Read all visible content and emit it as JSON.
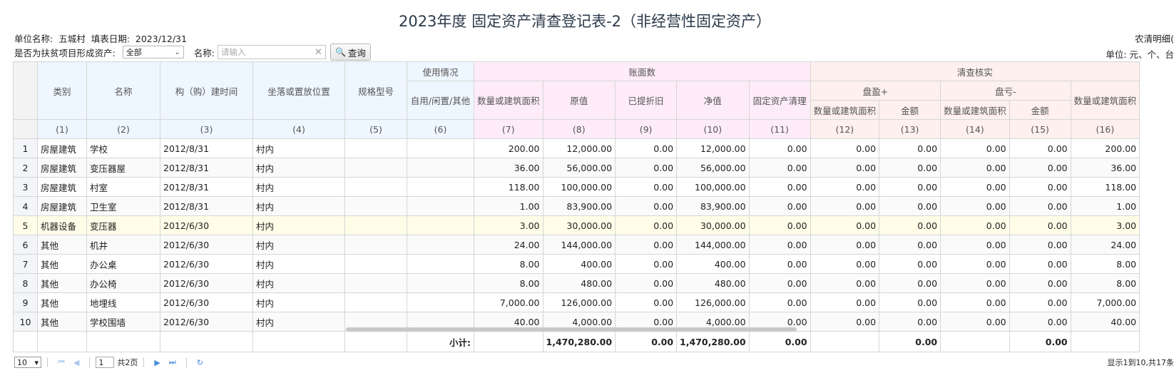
{
  "title": "2023年度 固定资产清查登记表-2（非经营性固定资产）",
  "meta": {
    "unit_label": "单位名称:",
    "unit_value": "五城村",
    "date_label": "填表日期:",
    "date_value": "2023/12/31",
    "right_top": "农清明细(",
    "right_unit": "单位: 元、个、台"
  },
  "filters": {
    "poverty_label": "是否为扶贫项目形成资产:",
    "poverty_value": "全部",
    "name_label": "名称:",
    "name_placeholder": "请输入",
    "query_label": "查询"
  },
  "headers": {
    "category": "类别",
    "name": "名称",
    "built_time": "构（购）建时间",
    "location": "坐落或置放位置",
    "spec": "规格型号",
    "usage_group": "使用情况",
    "usage": "自用/闲置/其他",
    "book_group": "账面数",
    "qty_area": "数量或建筑面积",
    "original": "原值",
    "depreciation": "已提折旧",
    "net": "净值",
    "cleanup": "固定资产清理",
    "verify_group": "清查核实",
    "surplus_group": "盘盈+",
    "loss_group": "盘亏-",
    "amount": "金额",
    "codes": [
      "(1)",
      "(2)",
      "(3)",
      "(4)",
      "(5)",
      "(6)",
      "(7)",
      "(8)",
      "(9)",
      "(10)",
      "(11)",
      "(12)",
      "(13)",
      "(14)",
      "(15)",
      "(16)"
    ]
  },
  "rows": [
    {
      "no": "1",
      "cat": "房屋建筑",
      "name": "学校",
      "time": "2012/8/31",
      "loc": "村内",
      "spec": "",
      "usage": "",
      "qty": "200.00",
      "orig": "12,000.00",
      "dep": "0.00",
      "net": "12,000.00",
      "clean": "0.00",
      "s_qty": "0.00",
      "s_amt": "0.00",
      "l_qty": "0.00",
      "l_amt": "0.00",
      "v_qty": "200.00"
    },
    {
      "no": "2",
      "cat": "房屋建筑",
      "name": "变压器屋",
      "time": "2012/8/31",
      "loc": "村内",
      "spec": "",
      "usage": "",
      "qty": "36.00",
      "orig": "56,000.00",
      "dep": "0.00",
      "net": "56,000.00",
      "clean": "0.00",
      "s_qty": "0.00",
      "s_amt": "0.00",
      "l_qty": "0.00",
      "l_amt": "0.00",
      "v_qty": "36.00"
    },
    {
      "no": "3",
      "cat": "房屋建筑",
      "name": "村室",
      "time": "2012/8/31",
      "loc": "村内",
      "spec": "",
      "usage": "",
      "qty": "118.00",
      "orig": "100,000.00",
      "dep": "0.00",
      "net": "100,000.00",
      "clean": "0.00",
      "s_qty": "0.00",
      "s_amt": "0.00",
      "l_qty": "0.00",
      "l_amt": "0.00",
      "v_qty": "118.00"
    },
    {
      "no": "4",
      "cat": "房屋建筑",
      "name": "卫生室",
      "time": "2012/8/31",
      "loc": "村内",
      "spec": "",
      "usage": "",
      "qty": "1.00",
      "orig": "83,900.00",
      "dep": "0.00",
      "net": "83,900.00",
      "clean": "0.00",
      "s_qty": "0.00",
      "s_amt": "0.00",
      "l_qty": "0.00",
      "l_amt": "0.00",
      "v_qty": "1.00"
    },
    {
      "no": "5",
      "cat": "机器设备",
      "name": "变压器",
      "time": "2012/6/30",
      "loc": "村内",
      "spec": "",
      "usage": "",
      "qty": "3.00",
      "orig": "30,000.00",
      "dep": "0.00",
      "net": "30,000.00",
      "clean": "0.00",
      "s_qty": "0.00",
      "s_amt": "0.00",
      "l_qty": "0.00",
      "l_amt": "0.00",
      "v_qty": "3.00"
    },
    {
      "no": "6",
      "cat": "其他",
      "name": "机井",
      "time": "2012/6/30",
      "loc": "村内",
      "spec": "",
      "usage": "",
      "qty": "24.00",
      "orig": "144,000.00",
      "dep": "0.00",
      "net": "144,000.00",
      "clean": "0.00",
      "s_qty": "0.00",
      "s_amt": "0.00",
      "l_qty": "0.00",
      "l_amt": "0.00",
      "v_qty": "24.00"
    },
    {
      "no": "7",
      "cat": "其他",
      "name": "办公桌",
      "time": "2012/6/30",
      "loc": "村内",
      "spec": "",
      "usage": "",
      "qty": "8.00",
      "orig": "400.00",
      "dep": "0.00",
      "net": "400.00",
      "clean": "0.00",
      "s_qty": "0.00",
      "s_amt": "0.00",
      "l_qty": "0.00",
      "l_amt": "0.00",
      "v_qty": "8.00"
    },
    {
      "no": "8",
      "cat": "其他",
      "name": "办公椅",
      "time": "2012/6/30",
      "loc": "村内",
      "spec": "",
      "usage": "",
      "qty": "8.00",
      "orig": "480.00",
      "dep": "0.00",
      "net": "480.00",
      "clean": "0.00",
      "s_qty": "0.00",
      "s_amt": "0.00",
      "l_qty": "0.00",
      "l_amt": "0.00",
      "v_qty": "8.00"
    },
    {
      "no": "9",
      "cat": "其他",
      "name": "地埋线",
      "time": "2012/6/30",
      "loc": "村内",
      "spec": "",
      "usage": "",
      "qty": "7,000.00",
      "orig": "126,000.00",
      "dep": "0.00",
      "net": "126,000.00",
      "clean": "0.00",
      "s_qty": "0.00",
      "s_amt": "0.00",
      "l_qty": "0.00",
      "l_amt": "0.00",
      "v_qty": "7,000.00"
    },
    {
      "no": "10",
      "cat": "其他",
      "name": "学校围墙",
      "time": "2012/6/30",
      "loc": "村内",
      "spec": "",
      "usage": "",
      "qty": "40.00",
      "orig": "4,000.00",
      "dep": "0.00",
      "net": "4,000.00",
      "clean": "0.00",
      "s_qty": "0.00",
      "s_amt": "0.00",
      "l_qty": "0.00",
      "l_amt": "0.00",
      "v_qty": "40.00"
    }
  ],
  "totals": {
    "label": "小计:",
    "orig": "1,470,280.00",
    "dep": "0.00",
    "net": "1,470,280.00",
    "clean": "0.00",
    "s_amt": "0.00",
    "l_amt": "0.00"
  },
  "pager": {
    "page_size": "10",
    "current_page": "1",
    "total_pages": "共2页",
    "info": "显示1到10,共17条"
  }
}
